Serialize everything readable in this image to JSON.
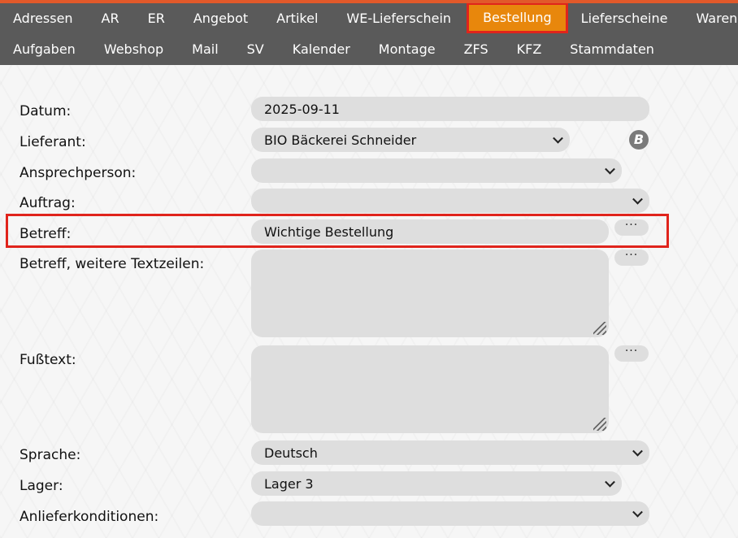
{
  "nav": {
    "row1": [
      "Adressen",
      "AR",
      "ER",
      "Angebot",
      "Artikel",
      "WE-Lieferschein",
      "Bestellung",
      "Lieferscheine",
      "Warenbew"
    ],
    "row2": [
      "Aufgaben",
      "Webshop",
      "Mail",
      "SV",
      "Kalender",
      "Montage",
      "ZFS",
      "KFZ",
      "Stammdaten"
    ],
    "active": "Bestellung"
  },
  "form": {
    "datum": {
      "label": "Datum:",
      "value": "2025-09-11"
    },
    "lieferant": {
      "label": "Lieferant:",
      "value": "BIO Bäckerei Schneider",
      "badge": "B"
    },
    "ansprechperson": {
      "label": "Ansprechperson:",
      "value": ""
    },
    "auftrag": {
      "label": "Auftrag:",
      "value": ""
    },
    "betreff": {
      "label": "Betreff:",
      "value": "Wichtige Bestellung",
      "more": "···"
    },
    "betreff_weitere": {
      "label": "Betreff, weitere Textzeilen:",
      "value": "",
      "more": "···"
    },
    "fusstext": {
      "label": "Fußtext:",
      "value": "",
      "more": "···"
    },
    "sprache": {
      "label": "Sprache:",
      "value": "Deutsch"
    },
    "lager": {
      "label": "Lager:",
      "value": "Lager 3"
    },
    "anlieferkonditionen": {
      "label": "Anlieferkonditionen:",
      "value": ""
    }
  },
  "colors": {
    "nav_bg": "#5a5a5a",
    "active_bg": "#e8870c",
    "highlight": "#e0241c",
    "field_bg": "#dedede"
  }
}
